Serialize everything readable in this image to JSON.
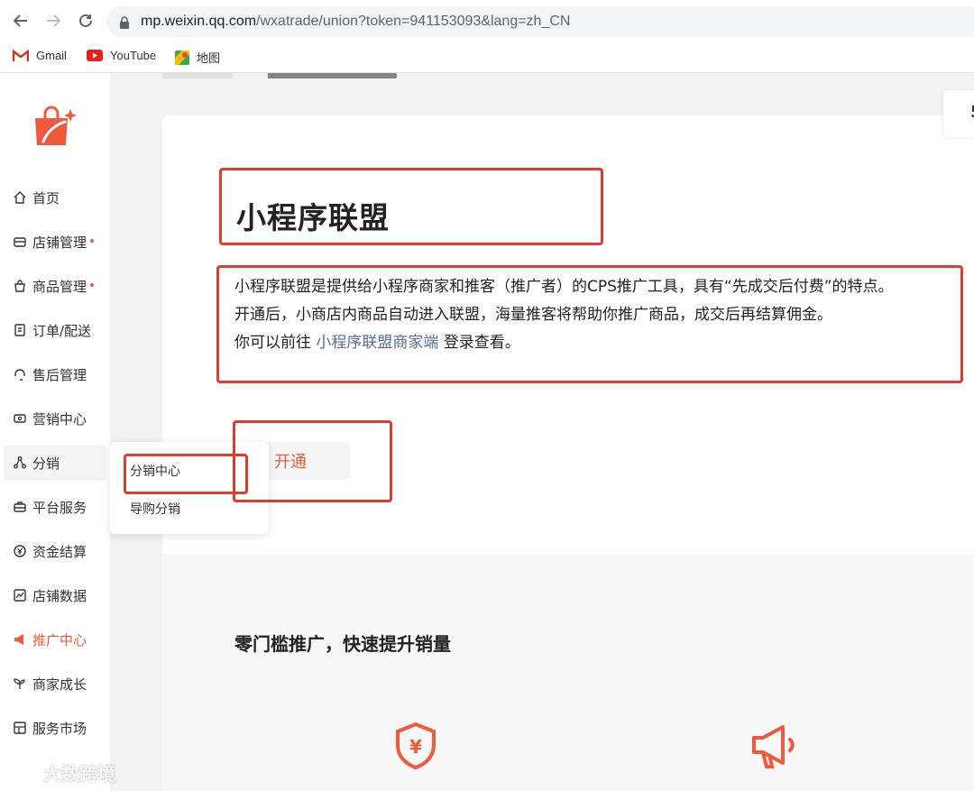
{
  "browser": {
    "url_host": "mp.weixin.qq.com",
    "url_path": "/wxatrade/union?token=941153093&lang=zh_CN",
    "bookmarks": [
      {
        "label": "Gmail",
        "icon": "gmail-icon"
      },
      {
        "label": "YouTube",
        "icon": "youtube-icon"
      },
      {
        "label": "地图",
        "icon": "maps-icon"
      }
    ]
  },
  "sidebar": {
    "items": [
      {
        "label": "首页",
        "icon": "home-icon"
      },
      {
        "label": "店铺管理",
        "icon": "store-icon",
        "dot": true
      },
      {
        "label": "商品管理",
        "icon": "bag-icon",
        "dot": true
      },
      {
        "label": "订单/配送",
        "icon": "order-icon"
      },
      {
        "label": "售后管理",
        "icon": "headset-icon"
      },
      {
        "label": "营销中心",
        "icon": "ticket-icon"
      },
      {
        "label": "分销",
        "icon": "share-icon"
      },
      {
        "label": "平台服务",
        "icon": "briefcase-icon"
      },
      {
        "label": "资金结算",
        "icon": "yen-icon"
      },
      {
        "label": "店铺数据",
        "icon": "chart-icon"
      },
      {
        "label": "推广中心",
        "icon": "megaphone-icon"
      },
      {
        "label": "商家成长",
        "icon": "sprout-icon"
      },
      {
        "label": "服务市场",
        "icon": "market-icon"
      }
    ]
  },
  "dropdown": {
    "items": [
      "分销中心",
      "导购分销"
    ]
  },
  "main": {
    "title": "小程序联盟",
    "desc_line1": "小程序联盟是提供给小程序商家和推客（推广者）的CPS推广工具，具有“先成交后付费”的特点。",
    "desc_line2": "开通后，小商店内商品自动进入联盟，海量推客将帮助你推广商品，成交后再结算佣金。",
    "desc_line3_prefix": "你可以前往 ",
    "desc_line3_link": "小程序联盟商家端",
    "desc_line3_suffix": " 登录查看。",
    "open_button": "开通",
    "section_title": "零门槛推广，快速提升销量"
  },
  "watermark": "大数跨境",
  "colors": {
    "accent": "#f05a3c",
    "link": "#576b95",
    "annotation": "#e03b2f"
  }
}
